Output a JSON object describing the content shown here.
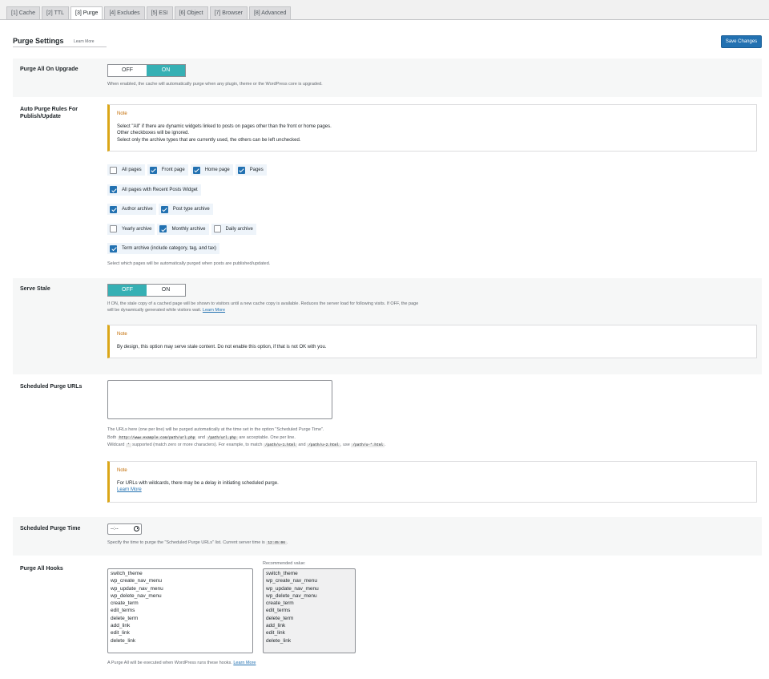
{
  "tabs": [
    "[1] Cache",
    "[2] TTL",
    "[3] Purge",
    "[4] Excludes",
    "[5] ESI",
    "[6] Object",
    "[7] Browser",
    "[8] Advanced"
  ],
  "header": {
    "title": "Purge Settings",
    "learn_more": "Learn More",
    "save_label": "Save Changes"
  },
  "switch_labels": {
    "off": "OFF",
    "on": "ON"
  },
  "purge_upgrade": {
    "label": "Purge All On Upgrade",
    "state": "ON",
    "desc": "When enabled, the cache will automatically purge when any plugin, theme or the WordPress core is upgraded."
  },
  "auto_purge": {
    "label_line1": "Auto Purge Rules For",
    "label_line2": "Publish/Update",
    "note_title": "Note",
    "note_lines": [
      "Select \"All\" if there are dynamic widgets linked to posts on pages other than the front or home pages.",
      "Other checkboxes will be ignored.",
      "Select only the archive types that are currently used, the others can be left unchecked."
    ],
    "rows": [
      [
        {
          "label": "All pages",
          "checked": false
        },
        {
          "label": "Front page",
          "checked": true
        },
        {
          "label": "Home page",
          "checked": true
        },
        {
          "label": "Pages",
          "checked": true
        }
      ],
      [
        {
          "label": "All pages with Recent Posts Widget",
          "checked": true
        }
      ],
      [
        {
          "label": "Author archive",
          "checked": true
        },
        {
          "label": "Post type archive",
          "checked": true
        }
      ],
      [
        {
          "label": "Yearly archive",
          "checked": false
        },
        {
          "label": "Monthly archive",
          "checked": true
        },
        {
          "label": "Daily archive",
          "checked": false
        }
      ],
      [
        {
          "label": "Term archive (include category, tag, and tax)",
          "checked": true
        }
      ]
    ],
    "desc": "Select which pages will be automatically purged when posts are published/updated."
  },
  "serve_stale": {
    "label": "Serve Stale",
    "state": "OFF",
    "desc_line1": "If ON, the stale copy of a cached page will be shown to visitors until a new cache copy is available. Reduces the server load for following visits. If OFF, the page",
    "desc_line2": "will be dynamically generated while visitors wait.",
    "learn_more": "Learn More",
    "note_title": "Note",
    "note_text": "By design, this option may serve stale content. Do not enable this option, if that is not OK with you."
  },
  "scheduled_urls": {
    "label": "Scheduled Purge URLs",
    "value": "",
    "desc_line1": "The URLs here (one per line) will be purged automatically at the time set in the option \"Scheduled Purge Time\".",
    "desc2_before": "Both",
    "code1": "http://www.example.com/path/url.php",
    "desc2_and": "and",
    "code2": "/path/url.php",
    "desc2_after": "are acceptable. One per line.",
    "desc3_before": "Wildcard",
    "code_wild": "*",
    "desc3_mid": "supported (match zero or more characters). For example, to match",
    "code3": "/path/u-1.html",
    "desc3_and": "and",
    "code4": "/path/u-2.html",
    "desc3_use": ", use",
    "code5": "/path/u-*.html",
    "desc3_end": ".",
    "note_title": "Note",
    "note_text": "For URLs with wildcards, there may be a delay in initiating scheduled purge.",
    "note_link": "Learn More"
  },
  "scheduled_time": {
    "label": "Scheduled Purge Time",
    "value": "--:--",
    "desc_before": "Specify the time to purge the \"Scheduled Purge URLs\" list. Current server time is",
    "server_time": "12:45:06",
    "desc_after": "."
  },
  "purge_hooks": {
    "label": "Purge All Hooks",
    "value": "switch_theme\nwp_create_nav_menu\nwp_update_nav_menu\nwp_delete_nav_menu\ncreate_term\nedit_terms\ndelete_term\nadd_link\nedit_link\ndelete_link",
    "recommended_label": "Recommended value:",
    "recommended_value": "switch_theme\nwp_create_nav_menu\nwp_update_nav_menu\nwp_delete_nav_menu\ncreate_term\nedit_terms\ndelete_term\nadd_link\nedit_link\ndelete_link",
    "desc": "A Purge All will be executed when WordPress runs these hooks.",
    "learn_more": "Learn More"
  },
  "colors": {
    "switch_on": "#36b0b4",
    "button": "#2271b1",
    "note_border": "#dba617"
  }
}
